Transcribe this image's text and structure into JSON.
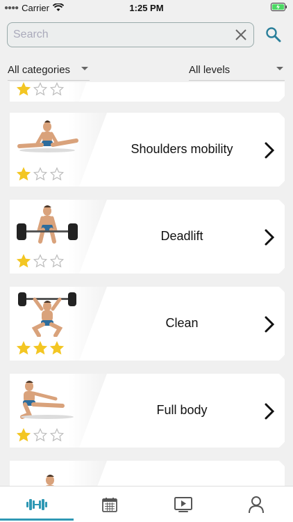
{
  "status_bar": {
    "carrier": "Carrier",
    "time": "1:25 PM"
  },
  "search": {
    "placeholder": "Search",
    "value": ""
  },
  "filters": {
    "category": "All categories",
    "level": "All levels"
  },
  "exercises": [
    {
      "title": "",
      "rating": 1
    },
    {
      "title": "Shoulders mobility",
      "rating": 1
    },
    {
      "title": "Deadlift",
      "rating": 1
    },
    {
      "title": "Clean",
      "rating": 3
    },
    {
      "title": "Full body",
      "rating": 1
    },
    {
      "title": "",
      "rating": 0
    }
  ],
  "tabbar": {
    "active": "workouts-tab",
    "accent": "#2f98b4"
  },
  "colors": {
    "star_filled": "#f3c623",
    "star_empty": "#bbbbbb",
    "icon": "#2a7f9a"
  }
}
